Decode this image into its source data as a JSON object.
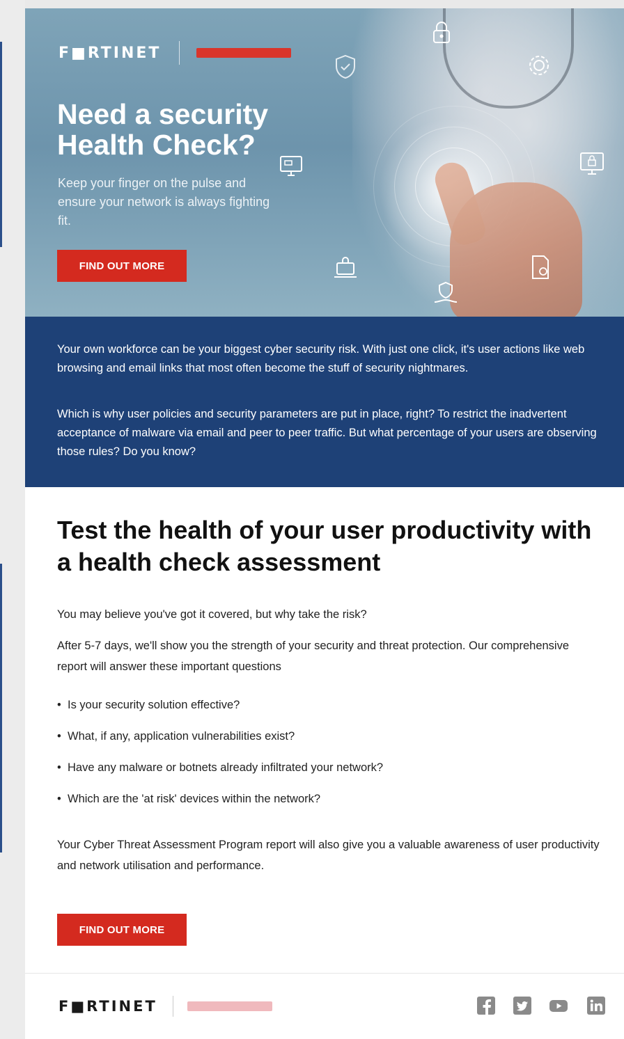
{
  "hero": {
    "logo": "F■RTINET",
    "title": "Need a security Health Check?",
    "subtitle": "Keep your finger on the pulse and ensure your network is always fighting fit.",
    "button_label": "FIND OUT MORE"
  },
  "band": {
    "paragraph_1": "Your own workforce can be your biggest cyber security risk.  With just one click, it's user actions like web browsing and email links that most often become the stuff of security nightmares.",
    "paragraph_2": "Which is why user policies and security parameters are put in place, right? To restrict the inadvertent acceptance of malware via email and peer to peer traffic. But what percentage of your users are observing those rules? Do you know?"
  },
  "body": {
    "headline": "Test the health of your user productivity with a health check assessment",
    "risk_line": "You may believe you've got it covered, but why take the risk?",
    "after_line": "After 5-7 days, we'll show you the strength of your security and threat protection. Our comprehensive report will answer these important questions",
    "bullets": [
      "Is your security solution effective?",
      "What, if any, application vulnerabilities exist?",
      "Have any malware or botnets already infiltrated your network?",
      "Which are the 'at risk' devices within the network?"
    ],
    "report_line": "Your Cyber Threat Assessment Program report will also give you a valuable awareness of user productivity and network utilisation and performance.",
    "button_label": "FIND OUT MORE"
  },
  "footer": {
    "logo": "F■RTINET",
    "social_icons": [
      "facebook-icon",
      "twitter-icon",
      "youtube-icon",
      "linkedin-icon"
    ]
  },
  "colors": {
    "brand_red": "#d42a1f",
    "band_blue": "#1e4177",
    "social_gray": "#8a8a8a"
  }
}
